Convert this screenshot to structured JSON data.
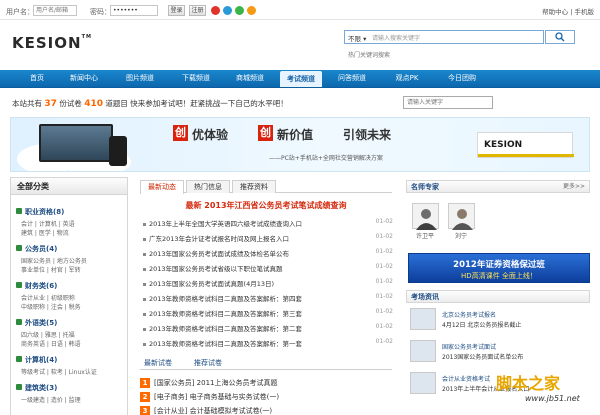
{
  "topbar": {
    "username_label": "用户名：",
    "username_placeholder": "用户名/邮箱",
    "password_label": "密码：",
    "password_value": "•••••••",
    "login_button": "登录",
    "register_link": "注册",
    "links": "帮助中心 | 手机版"
  },
  "header": {
    "logo_text": "KESION",
    "logo_tm": "TM",
    "search_type": "不限",
    "search_placeholder": "请输入搜索关键字",
    "hot_words": "热门关键词搜索"
  },
  "nav": {
    "items": [
      {
        "label": "首页"
      },
      {
        "label": "新闻中心"
      },
      {
        "label": "图片频道"
      },
      {
        "label": "下载频道"
      },
      {
        "label": "商城频道"
      },
      {
        "label": "考试频道",
        "active": true
      },
      {
        "label": "问答频道"
      },
      {
        "label": "观点PK"
      },
      {
        "label": "今日团购"
      }
    ]
  },
  "stats": {
    "prefix": "本站共有",
    "papers": "37",
    "mid": "份试卷",
    "questions": "410",
    "suffix": "道题目 快来参加考试吧！赶紧挑战一下自己的水平吧！",
    "user_search_placeholder": "请输入关键字"
  },
  "banner": {
    "tag1": "创",
    "text1": "优体验",
    "tag2": "创",
    "text2": "新价值",
    "text3": "引领未来",
    "subtitle": "——PC站+手机站+全网社交营销解决方案",
    "logo": "KESION"
  },
  "left": {
    "title": "全部分类",
    "categories": [
      {
        "name": "职业资格(8)",
        "subs": "会计 | 计算机 | 英语",
        "subs2": "建筑 | 医学 | 物流"
      },
      {
        "name": "公务员(4)",
        "subs": "国家公务员 | 地方公务员",
        "subs2": "事业单位 | 村官 | 军转"
      },
      {
        "name": "财务类(6)",
        "subs": "会计从业 | 初级职称",
        "subs2": "中级职称 | 注会 | 税务"
      },
      {
        "name": "外语类(5)",
        "subs": "四六级 | 雅思 | 托福",
        "subs2": "商务英语 | 日语 | 韩语"
      },
      {
        "name": "计算机(4)",
        "subs": "等级考试 | 软考 | Linux认证"
      },
      {
        "name": "建筑类(3)",
        "subs": "一级建造 | 造价 | 监理"
      }
    ]
  },
  "middle": {
    "tabs": [
      "最新动态",
      "热门信息",
      "推荐资料"
    ],
    "headline": "最新 2013年江西省公务员考试笔试成绩查询",
    "news": [
      {
        "title": "2013年上半年全国大学英语四六级考试成绩查询入口",
        "date": "01-02"
      },
      {
        "title": "广东2013年会计证考试报名时间及网上报名入口",
        "date": "01-02"
      },
      {
        "title": "2013年国家公务员考试面试成绩及体检名单公布",
        "date": "01-02"
      },
      {
        "title": "2013年国家公务员考试省级以下职位笔试真题",
        "date": "01-02"
      },
      {
        "title": "2013年国家公务员考试面试真题(4月13日)",
        "date": "01-02"
      },
      {
        "title": "2013年教师资格考试科目二真题及答案解析：第四套",
        "date": "01-02"
      },
      {
        "title": "2013年教师资格考试科目二真题及答案解析：第三套",
        "date": "01-02"
      },
      {
        "title": "2013年教师资格考试科目二真题及答案解析：第二套",
        "date": "01-02"
      },
      {
        "title": "2013年教师资格考试科目二真题及答案解析：第一套",
        "date": "01-02"
      }
    ],
    "tabs2": [
      "最新试卷",
      "推荐试卷"
    ],
    "ranks": [
      {
        "n": "1",
        "title": "[国家公务员] 2011上海公务员考试真题"
      },
      {
        "n": "2",
        "title": "[电子商务] 电子商务基础与实务试卷(一)"
      },
      {
        "n": "3",
        "title": "[会计从业] 会计基础模拟考试试卷(一)"
      }
    ]
  },
  "right": {
    "experts_title": "名师专家",
    "more": "更多>>",
    "experts": [
      "许卫平",
      "刘宁"
    ],
    "ad_line1": "2012年证券资格保过班",
    "ad_line2": "HD高清课件 全面上线！",
    "news_title": "考场资讯",
    "items": [
      {
        "text": "北京公务员考试报名",
        "line2": "4月12日 北京公务员报名截止",
        "blue": true
      },
      {
        "text": "国家公务员考试面试",
        "line2": "2013国家公务员面试名单公布"
      },
      {
        "text": "会计从业资格考试",
        "line2": "2013年上半年会计从业报名入口"
      }
    ]
  },
  "watermark": {
    "line1": "脚本之家",
    "line2": "www.jb51.net"
  },
  "colors": {
    "nav_blue": "#0d67ad",
    "highlight": "#ff6600",
    "headline_red": "#d42a0f"
  }
}
